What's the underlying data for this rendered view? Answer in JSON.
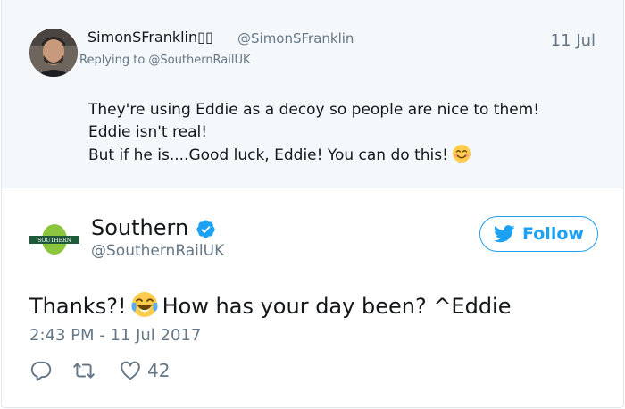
{
  "parent_tweet": {
    "display_name": "SimonSFranklin▯▯",
    "handle": "@SimonSFranklin",
    "time": "11 Jul",
    "replying_to": "Replying to @SouthernRailUK",
    "lines": [
      "They're using Eddie as a decoy so people are nice to them!",
      "Eddie isn't real!",
      "But if he is....Good luck, Eddie! You can do this!"
    ],
    "emoji": "smiling-face-icon"
  },
  "tweet": {
    "display_name": "Southern",
    "handle": "@SouthernRailUK",
    "avatar_text": "SOUTHERN",
    "follow_label": "Follow",
    "text_before_emoji": "Thanks?!",
    "text_after_emoji": "How has your day been? ^Eddie",
    "emoji": "face-with-tears-of-joy-icon",
    "timestamp": "2:43 PM - 11 Jul 2017",
    "like_count": "42"
  },
  "colors": {
    "accent": "#1da1f2",
    "muted": "#657786",
    "text": "#14171a",
    "parent_bg": "#f5f8fa",
    "southern_green": "#8cc63f",
    "southern_dark": "#1f5b3a"
  },
  "icons": [
    "reply-icon",
    "retweet-icon",
    "heart-icon",
    "twitter-bird-icon",
    "verified-badge-icon"
  ]
}
